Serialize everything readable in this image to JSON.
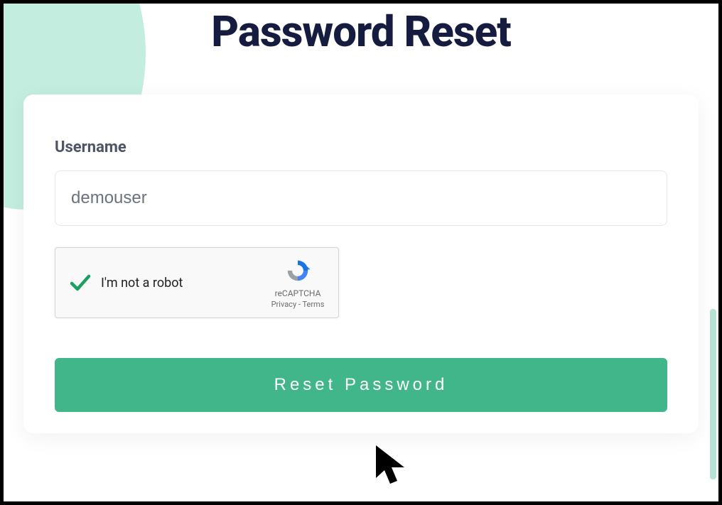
{
  "page": {
    "title": "Password Reset"
  },
  "form": {
    "username_label": "Username",
    "username_value": "demouser",
    "submit_label": "Reset Password"
  },
  "recaptcha": {
    "label": "I'm not a robot",
    "brand": "reCAPTCHA",
    "privacy": "Privacy",
    "terms": "Terms",
    "separator": " - ",
    "checked": true
  },
  "colors": {
    "accent": "#42b68b",
    "title": "#151c3f",
    "decor": "#c3eedf"
  }
}
